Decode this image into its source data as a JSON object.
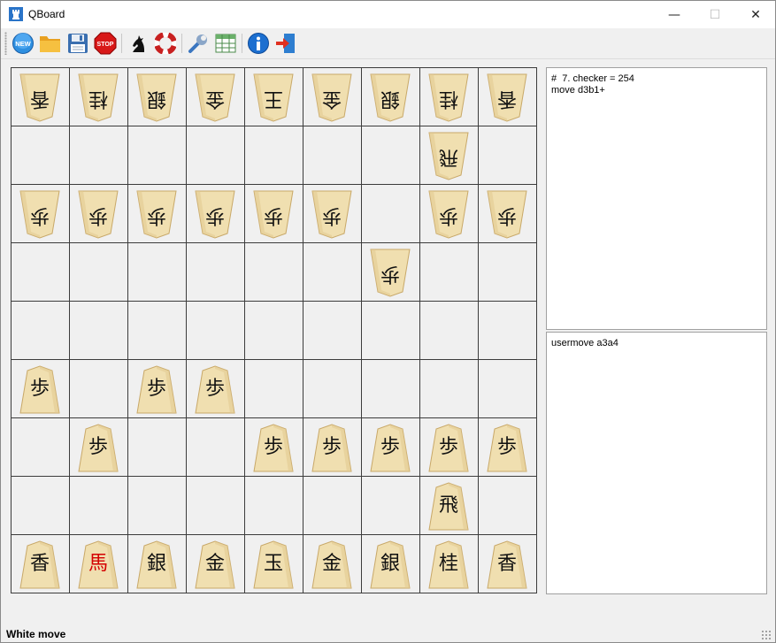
{
  "window": {
    "title": "QBoard",
    "minimize_glyph": "—",
    "maximize_glyph": "☐",
    "close_glyph": "✕"
  },
  "toolbar": {
    "buttons": [
      {
        "name": "new-game-button",
        "icon": "new-icon",
        "label": "NEW"
      },
      {
        "name": "open-button",
        "icon": "folder-icon"
      },
      {
        "name": "save-button",
        "icon": "floppy-disk-icon"
      },
      {
        "name": "stop-button",
        "icon": "stop-sign-icon",
        "label": "STOP"
      },
      {
        "name": "engine-button",
        "icon": "knight-icon"
      },
      {
        "name": "help-lifebuoy-button",
        "icon": "lifebuoy-icon"
      },
      {
        "name": "settings-button",
        "icon": "wrench-icon"
      },
      {
        "name": "table-button",
        "icon": "table-icon"
      },
      {
        "name": "about-button",
        "icon": "info-icon"
      },
      {
        "name": "exit-button",
        "icon": "exit-icon"
      }
    ]
  },
  "colors": {
    "piece_wood": "#f0dfb0",
    "piece_edge": "#c8a868",
    "promoted": "#d40000",
    "board_line": "#3c3c3c"
  },
  "board": {
    "rows": [
      [
        {
          "k": "香",
          "side": "gote"
        },
        {
          "k": "桂",
          "side": "gote"
        },
        {
          "k": "銀",
          "side": "gote"
        },
        {
          "k": "金",
          "side": "gote"
        },
        {
          "k": "王",
          "side": "gote"
        },
        {
          "k": "金",
          "side": "gote"
        },
        {
          "k": "銀",
          "side": "gote"
        },
        {
          "k": "桂",
          "side": "gote"
        },
        {
          "k": "香",
          "side": "gote"
        }
      ],
      [
        null,
        null,
        null,
        null,
        null,
        null,
        null,
        {
          "k": "飛",
          "side": "gote"
        },
        null
      ],
      [
        {
          "k": "歩",
          "side": "gote"
        },
        {
          "k": "歩",
          "side": "gote"
        },
        {
          "k": "歩",
          "side": "gote"
        },
        {
          "k": "歩",
          "side": "gote"
        },
        {
          "k": "歩",
          "side": "gote"
        },
        {
          "k": "歩",
          "side": "gote"
        },
        null,
        {
          "k": "歩",
          "side": "gote"
        },
        {
          "k": "歩",
          "side": "gote"
        }
      ],
      [
        null,
        null,
        null,
        null,
        null,
        null,
        {
          "k": "歩",
          "side": "gote"
        },
        null,
        null
      ],
      [
        null,
        null,
        null,
        null,
        null,
        null,
        null,
        null,
        null
      ],
      [
        {
          "k": "歩",
          "side": "sente"
        },
        null,
        {
          "k": "歩",
          "side": "sente"
        },
        {
          "k": "歩",
          "side": "sente"
        },
        null,
        null,
        null,
        null,
        null
      ],
      [
        null,
        {
          "k": "歩",
          "side": "sente"
        },
        null,
        null,
        {
          "k": "歩",
          "side": "sente"
        },
        {
          "k": "歩",
          "side": "sente"
        },
        {
          "k": "歩",
          "side": "sente"
        },
        {
          "k": "歩",
          "side": "sente"
        },
        {
          "k": "歩",
          "side": "sente"
        }
      ],
      [
        null,
        null,
        null,
        null,
        null,
        null,
        null,
        {
          "k": "飛",
          "side": "sente"
        },
        null
      ],
      [
        {
          "k": "香",
          "side": "sente"
        },
        {
          "k": "馬",
          "side": "sente",
          "promoted": true
        },
        {
          "k": "銀",
          "side": "sente"
        },
        {
          "k": "金",
          "side": "sente"
        },
        {
          "k": "玉",
          "side": "sente"
        },
        {
          "k": "金",
          "side": "sente"
        },
        {
          "k": "銀",
          "side": "sente"
        },
        {
          "k": "桂",
          "side": "sente"
        },
        {
          "k": "香",
          "side": "sente"
        }
      ]
    ]
  },
  "engine_log": {
    "lines": [
      "#  7. checker = 254",
      "move d3b1+"
    ]
  },
  "user_log": {
    "lines": [
      "usermove a3a4"
    ]
  },
  "status": {
    "text": "White move"
  }
}
